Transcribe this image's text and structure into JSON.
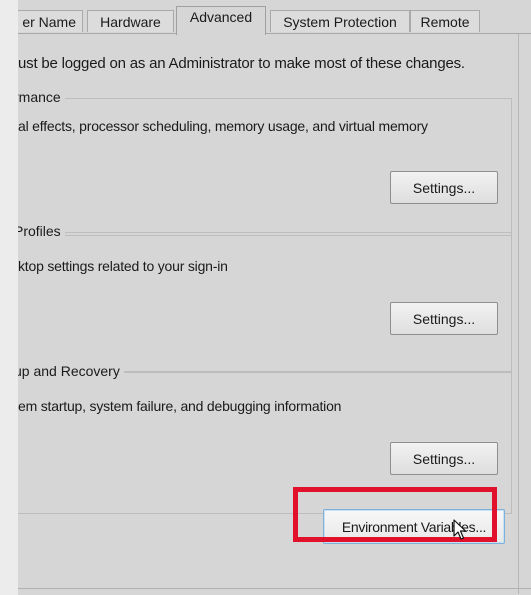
{
  "tabs": [
    {
      "label": "er Name"
    },
    {
      "label": "Hardware"
    },
    {
      "label": "Advanced"
    },
    {
      "label": "System Protection"
    },
    {
      "label": "Remote"
    }
  ],
  "admin_note": "ust be logged on as an Administrator to make most of these changes.",
  "groups": {
    "performance": {
      "legend": "rmance",
      "description": "al effects, processor scheduling, memory usage, and virtual memory",
      "button_label": "Settings..."
    },
    "user_profiles": {
      "legend": "Profiles",
      "description": "ktop settings related to your sign-in",
      "button_label": "Settings..."
    },
    "startup_recovery": {
      "legend": "up and Recovery",
      "description": "em startup, system failure, and debugging information",
      "button_label": "Settings..."
    }
  },
  "environment_button_label": "Environment Variables...",
  "colors": {
    "highlight": "#e2112b",
    "dialog_bg": "#d6d6d6"
  },
  "icons": {
    "cursor": "mouse-pointer-icon"
  }
}
